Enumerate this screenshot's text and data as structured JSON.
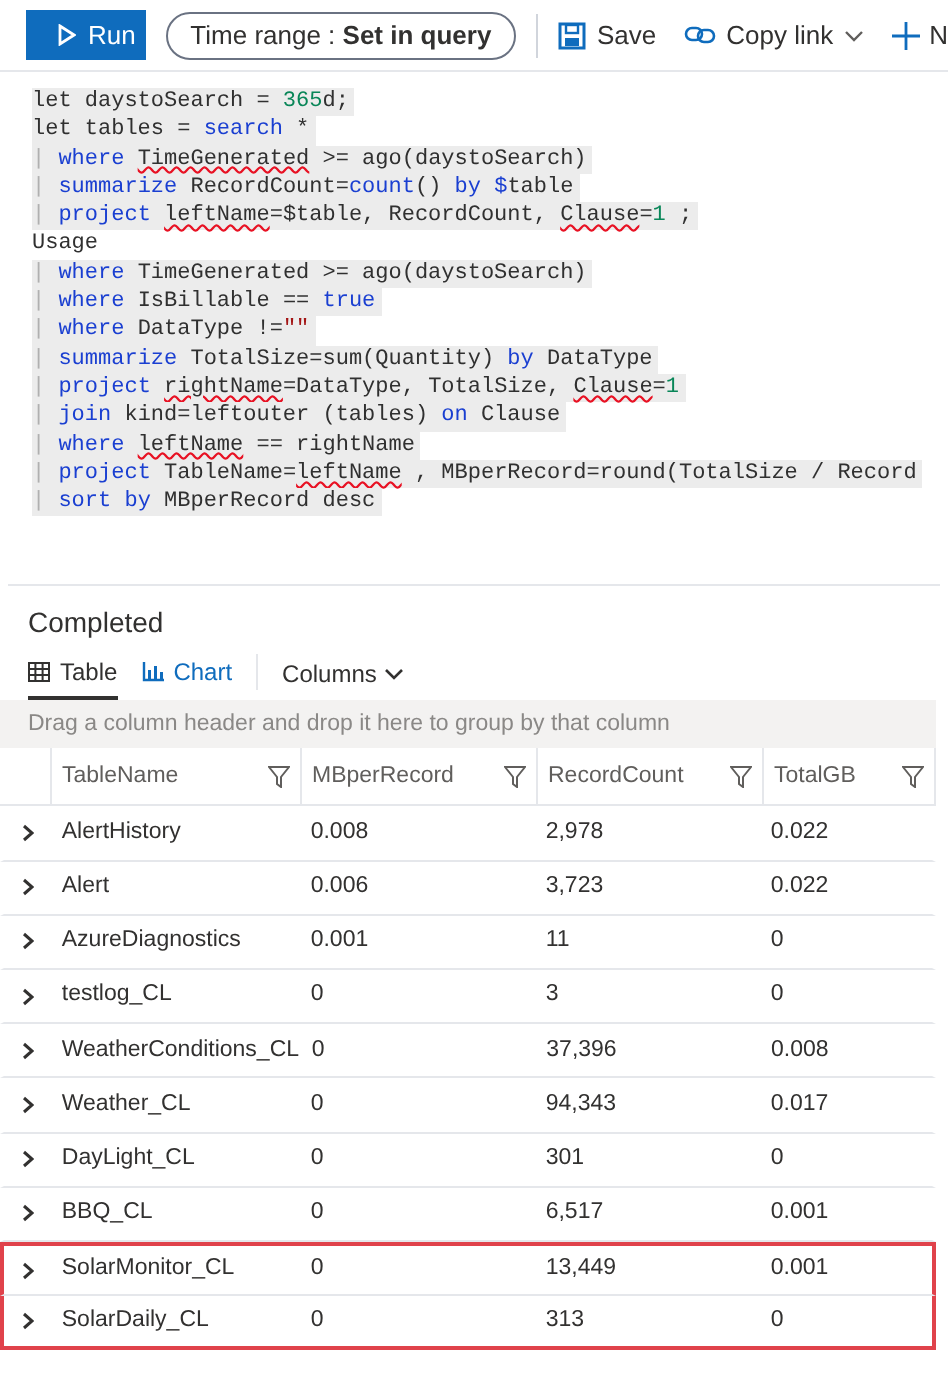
{
  "toolbar": {
    "run_button": "Run",
    "time_range": "Time range : **Set in query**",
    "save": "Save",
    "copy_link": "Copy link",
    "new": "N"
  },
  "query_lines": [
    {
      "highlighted": true,
      "tokens": [
        {
          "kind": "plain",
          "text": "let daystoSearch = "
        },
        {
          "kind": "number",
          "text": "365"
        },
        {
          "kind": "plain",
          "text": "d;"
        }
      ]
    },
    {
      "highlighted": true,
      "tokens": [
        {
          "kind": "plain",
          "text": "let tables = "
        },
        {
          "kind": "keyword",
          "text": "search"
        },
        {
          "kind": "plain",
          "text": " *"
        }
      ]
    },
    {
      "highlighted": true,
      "tokens": [
        {
          "kind": "pipe",
          "text": "|"
        },
        {
          "kind": "keyword",
          "text": " where "
        },
        {
          "kind": "error",
          "text": "TimeGenerated"
        },
        {
          "kind": "plain",
          "text": " >= ago(daystoSearch)"
        }
      ]
    },
    {
      "highlighted": true,
      "tokens": [
        {
          "kind": "pipe",
          "text": "|"
        },
        {
          "kind": "keyword",
          "text": " summarize "
        },
        {
          "kind": "plain",
          "text": "RecordCount="
        },
        {
          "kind": "keyword",
          "text": "count"
        },
        {
          "kind": "plain",
          "text": "()"
        },
        {
          "kind": "keyword",
          "text": " by $"
        },
        {
          "kind": "plain",
          "text": "table"
        }
      ]
    },
    {
      "highlighted": true,
      "tokens": [
        {
          "kind": "pipe",
          "text": "|"
        },
        {
          "kind": "keyword",
          "text": " project "
        },
        {
          "kind": "error",
          "text": "leftName"
        },
        {
          "kind": "plain",
          "text": "=$table, RecordCount, "
        },
        {
          "kind": "error",
          "text": "Clause"
        },
        {
          "kind": "plain",
          "text": "="
        },
        {
          "kind": "number",
          "text": "1"
        },
        {
          "kind": "plain",
          "text": " ;"
        }
      ]
    },
    {
      "highlighted": false,
      "tokens": [
        {
          "kind": "plain",
          "text": "Usage"
        }
      ]
    },
    {
      "highlighted": true,
      "tokens": [
        {
          "kind": "pipe",
          "text": "|"
        },
        {
          "kind": "keyword",
          "text": " where "
        },
        {
          "kind": "plain",
          "text": "TimeGenerated >= ago(daystoSearch)"
        }
      ]
    },
    {
      "highlighted": true,
      "tokens": [
        {
          "kind": "pipe",
          "text": "|"
        },
        {
          "kind": "keyword",
          "text": " where "
        },
        {
          "kind": "plain",
          "text": "IsBillable == "
        },
        {
          "kind": "keyword",
          "text": "true"
        }
      ]
    },
    {
      "highlighted": true,
      "tokens": [
        {
          "kind": "pipe",
          "text": "|"
        },
        {
          "kind": "keyword",
          "text": " where "
        },
        {
          "kind": "plain",
          "text": "DataType !="
        },
        {
          "kind": "string",
          "text": "\"\""
        }
      ]
    },
    {
      "highlighted": true,
      "tokens": [
        {
          "kind": "pipe",
          "text": "|"
        },
        {
          "kind": "keyword",
          "text": " summarize "
        },
        {
          "kind": "plain",
          "text": "TotalSize=sum(Quantity) "
        },
        {
          "kind": "keyword",
          "text": "by"
        },
        {
          "kind": "plain",
          "text": " DataType"
        }
      ]
    },
    {
      "highlighted": true,
      "tokens": [
        {
          "kind": "pipe",
          "text": "|"
        },
        {
          "kind": "keyword",
          "text": " project "
        },
        {
          "kind": "error",
          "text": "rightName"
        },
        {
          "kind": "plain",
          "text": "=DataType, TotalSize, "
        },
        {
          "kind": "error",
          "text": "Clause"
        },
        {
          "kind": "plain",
          "text": "="
        },
        {
          "kind": "number",
          "text": "1"
        }
      ]
    },
    {
      "highlighted": true,
      "tokens": [
        {
          "kind": "pipe",
          "text": "|"
        },
        {
          "kind": "keyword",
          "text": " join "
        },
        {
          "kind": "plain",
          "text": "kind=leftouter (tables) "
        },
        {
          "kind": "keyword",
          "text": "on"
        },
        {
          "kind": "plain",
          "text": " Clause"
        }
      ]
    },
    {
      "highlighted": true,
      "tokens": [
        {
          "kind": "pipe",
          "text": "|"
        },
        {
          "kind": "keyword",
          "text": " where "
        },
        {
          "kind": "error",
          "text": "leftName"
        },
        {
          "kind": "plain",
          "text": " == rightName"
        }
      ]
    },
    {
      "highlighted": true,
      "tokens": [
        {
          "kind": "pipe",
          "text": "|"
        },
        {
          "kind": "keyword",
          "text": " project "
        },
        {
          "kind": "plain",
          "text": "TableName="
        },
        {
          "kind": "error",
          "text": "leftName"
        },
        {
          "kind": "plain",
          "text": " , MBperRecord=round(TotalSize / Record"
        }
      ]
    },
    {
      "highlighted": true,
      "tokens": [
        {
          "kind": "pipe",
          "text": "|"
        },
        {
          "kind": "keyword",
          "text": " sort by "
        },
        {
          "kind": "plain",
          "text": "MBperRecord desc"
        }
      ]
    }
  ],
  "results": {
    "status": "Completed",
    "view_tabs": [
      {
        "label": "Table",
        "selected": true,
        "kind": "table"
      },
      {
        "label": "Chart",
        "selected": false,
        "kind": "chart"
      }
    ],
    "columns_menu": "Columns",
    "group_hint": "Drag a column header and drop it here to group by that column",
    "table": {
      "columns": [
        "TableName",
        "MBperRecord",
        "RecordCount",
        "TotalGB"
      ],
      "rows": [
        {
          "cells": [
            "AlertHistory",
            "0.008",
            "2,978",
            "0.022"
          ],
          "highlighted": false
        },
        {
          "cells": [
            "Alert",
            "0.006",
            "3,723",
            "0.022"
          ],
          "highlighted": false
        },
        {
          "cells": [
            "AzureDiagnostics",
            "0.001",
            "11",
            "0"
          ],
          "highlighted": false
        },
        {
          "cells": [
            "testlog_CL",
            "0",
            "3",
            "0"
          ],
          "highlighted": false
        },
        {
          "cells": [
            "WeatherConditions_CL",
            "0",
            "37,396",
            "0.008"
          ],
          "highlighted": false
        },
        {
          "cells": [
            "Weather_CL",
            "0",
            "94,343",
            "0.017"
          ],
          "highlighted": false
        },
        {
          "cells": [
            "DayLight_CL",
            "0",
            "301",
            "0"
          ],
          "highlighted": false
        },
        {
          "cells": [
            "BBQ_CL",
            "0",
            "6,517",
            "0.001"
          ],
          "highlighted": false
        },
        {
          "cells": [
            "SolarMonitor_CL",
            "0",
            "13,449",
            "0.001"
          ],
          "highlighted": true
        },
        {
          "cells": [
            "SolarDaily_CL",
            "0",
            "313",
            "0"
          ],
          "highlighted": true
        }
      ]
    }
  }
}
